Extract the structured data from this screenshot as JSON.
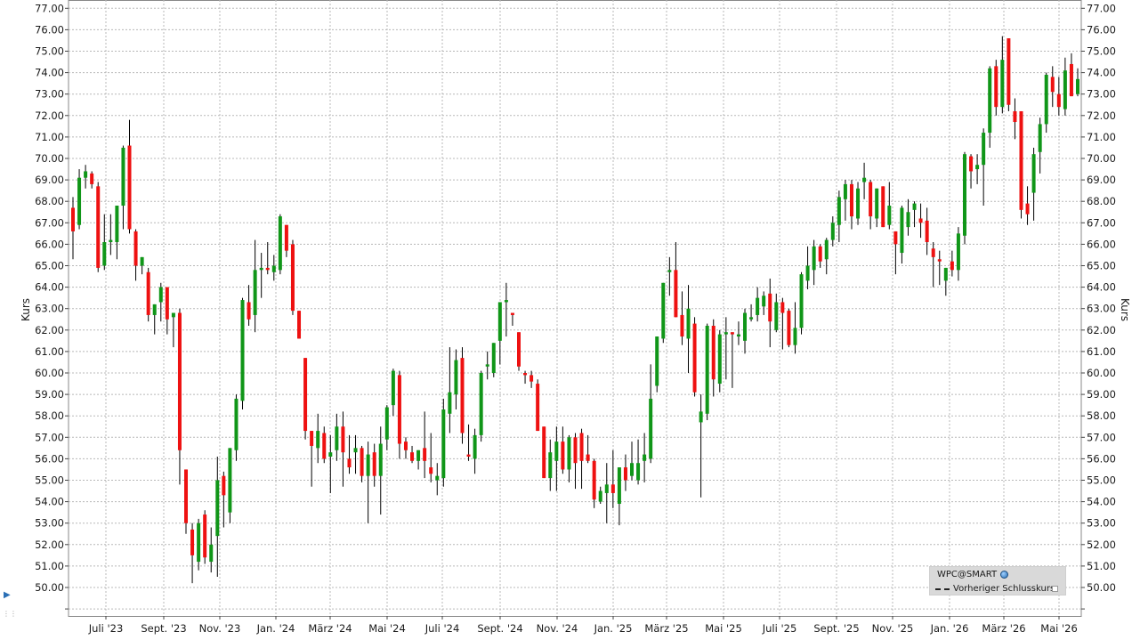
{
  "chart_data": {
    "type": "candlestick",
    "ylabel_left": "Kurs",
    "ylabel_right": "Kurs",
    "ylim": [
      49,
      77
    ],
    "y_ticks": [
      "50.00",
      "51.00",
      "52.00",
      "53.00",
      "54.00",
      "55.00",
      "56.00",
      "57.00",
      "58.00",
      "59.00",
      "60.00",
      "61.00",
      "62.00",
      "63.00",
      "64.00",
      "65.00",
      "66.00",
      "67.00",
      "68.00",
      "69.00",
      "70.00",
      "71.00",
      "72.00",
      "73.00",
      "74.00",
      "75.00",
      "76.00",
      "77.00"
    ],
    "x_labels": [
      "Juli '23",
      "Sept. '23",
      "Nov. '23",
      "Jan. '24",
      "März '24",
      "Mai '24",
      "Juli '24",
      "Sept. '24",
      "Nov. '24",
      "Jan. '25",
      "März '25",
      "Mai '25",
      "Juli '25",
      "Sept. '25",
      "Nov. '25",
      "Jan. '26",
      "März '26",
      "Mai '26"
    ],
    "grid": true,
    "colors": {
      "up": "#109618",
      "down": "#ee1111",
      "grid": "#b8b8b8",
      "wick": "#000000"
    },
    "legend_position": "bottom-right",
    "candles": [
      [
        67.7,
        68.2,
        65.3,
        66.6
      ],
      [
        66.9,
        69.5,
        66.7,
        69.1
      ],
      [
        69.1,
        69.7,
        68.6,
        69.4
      ],
      [
        69.3,
        69.4,
        68.6,
        68.8
      ],
      [
        68.7,
        68.9,
        64.7,
        64.9
      ],
      [
        65.0,
        67.4,
        64.8,
        66.1
      ],
      [
        66.1,
        67.4,
        65.5,
        66.2
      ],
      [
        66.1,
        67.6,
        65.3,
        67.8
      ],
      [
        67.8,
        70.6,
        66.7,
        70.5
      ],
      [
        70.6,
        71.8,
        66.5,
        66.7
      ],
      [
        66.6,
        66.7,
        64.3,
        65.0
      ],
      [
        65.0,
        65.4,
        64.6,
        65.4
      ],
      [
        64.7,
        64.9,
        62.4,
        62.7
      ],
      [
        62.7,
        63.2,
        61.8,
        63.2
      ],
      [
        63.3,
        64.2,
        62.4,
        64.0
      ],
      [
        64.0,
        64.0,
        61.8,
        62.5
      ],
      [
        62.6,
        62.8,
        61.2,
        62.8
      ],
      [
        62.8,
        63.0,
        54.8,
        56.4
      ],
      [
        55.5,
        55.5,
        52.5,
        53.0
      ],
      [
        52.7,
        53.0,
        50.2,
        51.5
      ],
      [
        51.2,
        53.2,
        50.8,
        53.0
      ],
      [
        53.4,
        53.6,
        51.1,
        51.4
      ],
      [
        51.2,
        52.8,
        50.7,
        52.0
      ],
      [
        52.4,
        56.1,
        50.5,
        55.0
      ],
      [
        55.2,
        55.4,
        52.8,
        54.3
      ],
      [
        53.5,
        56.4,
        53.0,
        56.5
      ],
      [
        56.4,
        59.0,
        55.9,
        58.8
      ],
      [
        58.7,
        63.5,
        58.3,
        63.4
      ],
      [
        63.3,
        64.1,
        62.2,
        62.5
      ],
      [
        62.7,
        66.2,
        61.9,
        64.8
      ],
      [
        64.8,
        65.6,
        63.5,
        64.9
      ],
      [
        64.9,
        66.1,
        64.6,
        64.8
      ],
      [
        64.7,
        65.5,
        64.3,
        65.0
      ],
      [
        64.8,
        67.4,
        64.6,
        67.3
      ],
      [
        66.9,
        66.8,
        65.4,
        65.7
      ],
      [
        66.0,
        66.2,
        62.7,
        62.9
      ],
      [
        62.9,
        62.9,
        61.7,
        61.6
      ],
      [
        60.7,
        60.7,
        56.9,
        57.3
      ],
      [
        57.3,
        57.3,
        54.7,
        56.6
      ],
      [
        56.5,
        58.1,
        55.8,
        57.3
      ],
      [
        57.2,
        57.5,
        55.8,
        56.0
      ],
      [
        56.1,
        57.1,
        54.4,
        56.3
      ],
      [
        56.4,
        58.1,
        55.9,
        57.5
      ],
      [
        57.5,
        58.2,
        54.7,
        56.3
      ],
      [
        56.0,
        57.1,
        55.3,
        55.6
      ],
      [
        56.3,
        57.1,
        55.3,
        56.5
      ],
      [
        56.5,
        56.6,
        54.9,
        55.2
      ],
      [
        55.2,
        56.8,
        53.0,
        56.2
      ],
      [
        56.3,
        56.7,
        54.7,
        55.2
      ],
      [
        55.2,
        57.5,
        53.4,
        56.7
      ],
      [
        56.9,
        58.5,
        56.4,
        58.4
      ],
      [
        58.5,
        60.2,
        58.0,
        60.1
      ],
      [
        59.9,
        60.1,
        56.0,
        56.7
      ],
      [
        56.8,
        57.0,
        56.0,
        56.4
      ],
      [
        56.3,
        56.6,
        55.8,
        55.9
      ],
      [
        55.9,
        56.4,
        55.5,
        56.4
      ],
      [
        56.5,
        58.2,
        55.1,
        55.9
      ],
      [
        55.6,
        57.2,
        54.9,
        55.3
      ],
      [
        55.0,
        55.8,
        54.3,
        55.2
      ],
      [
        55.1,
        58.8,
        54.7,
        58.3
      ],
      [
        58.1,
        61.2,
        57.2,
        59.1
      ],
      [
        59.0,
        61.1,
        58.3,
        60.6
      ],
      [
        60.7,
        61.2,
        56.7,
        57.2
      ],
      [
        56.2,
        57.6,
        55.9,
        56.1
      ],
      [
        56.0,
        57.4,
        55.3,
        57.1
      ],
      [
        57.1,
        60.1,
        56.8,
        60.0
      ],
      [
        60.3,
        61.0,
        59.7,
        60.4
      ],
      [
        60.0,
        61.1,
        59.8,
        61.4
      ],
      [
        61.5,
        63.3,
        60.4,
        63.3
      ],
      [
        63.3,
        64.2,
        61.7,
        63.4
      ],
      [
        62.8,
        62.8,
        62.2,
        62.7
      ],
      [
        61.9,
        61.9,
        60.1,
        60.3
      ],
      [
        60.0,
        60.1,
        59.5,
        59.9
      ],
      [
        59.9,
        60.1,
        59.3,
        59.6
      ],
      [
        59.5,
        59.7,
        58.0,
        57.3
      ],
      [
        57.5,
        57.5,
        55.1,
        55.1
      ],
      [
        55.1,
        56.9,
        54.5,
        56.3
      ],
      [
        55.9,
        57.5,
        54.5,
        56.8
      ],
      [
        56.8,
        57.5,
        55.3,
        55.5
      ],
      [
        55.5,
        57.1,
        54.9,
        57.0
      ],
      [
        57.0,
        57.2,
        54.6,
        55.8
      ],
      [
        57.2,
        57.4,
        54.6,
        55.9
      ],
      [
        56.2,
        57.1,
        55.8,
        55.9
      ],
      [
        55.9,
        56.0,
        53.7,
        54.1
      ],
      [
        54.0,
        54.7,
        53.9,
        54.5
      ],
      [
        54.4,
        55.8,
        53.0,
        54.8
      ],
      [
        54.8,
        56.4,
        53.7,
        54.4
      ],
      [
        53.9,
        55.6,
        52.9,
        55.6
      ],
      [
        55.6,
        56.2,
        54.5,
        55.0
      ],
      [
        55.2,
        56.8,
        55.0,
        55.8
      ],
      [
        55.0,
        56.9,
        54.8,
        55.8
      ],
      [
        55.9,
        57.2,
        54.9,
        56.2
      ],
      [
        56.0,
        60.4,
        55.8,
        58.8
      ],
      [
        59.4,
        61.3,
        59.1,
        61.7
      ],
      [
        61.6,
        64.2,
        61.4,
        64.2
      ],
      [
        64.7,
        65.4,
        63.6,
        64.8
      ],
      [
        64.8,
        66.1,
        62.6,
        62.6
      ],
      [
        62.7,
        63.8,
        61.3,
        61.7
      ],
      [
        61.6,
        64.1,
        60.0,
        63.0
      ],
      [
        62.3,
        62.6,
        58.9,
        59.1
      ],
      [
        57.7,
        59.0,
        54.2,
        58.2
      ],
      [
        58.1,
        62.3,
        57.8,
        62.2
      ],
      [
        62.2,
        62.5,
        58.9,
        59.7
      ],
      [
        59.5,
        62.0,
        59.1,
        61.8
      ],
      [
        61.8,
        62.6,
        59.7,
        61.9
      ],
      [
        61.9,
        61.8,
        59.3,
        61.8
      ],
      [
        61.7,
        62.4,
        61.3,
        61.8
      ],
      [
        61.5,
        63.0,
        60.9,
        62.8
      ],
      [
        62.5,
        63.2,
        62.4,
        62.6
      ],
      [
        62.7,
        64.0,
        62.4,
        63.5
      ],
      [
        63.1,
        63.8,
        62.7,
        63.6
      ],
      [
        63.7,
        64.4,
        61.2,
        62.4
      ],
      [
        62.0,
        63.7,
        61.9,
        63.3
      ],
      [
        63.3,
        63.5,
        61.1,
        62.8
      ],
      [
        62.9,
        63.0,
        61.2,
        61.3
      ],
      [
        61.3,
        63.3,
        60.9,
        62.1
      ],
      [
        62.1,
        64.7,
        61.8,
        64.6
      ],
      [
        64.3,
        65.9,
        63.9,
        65.0
      ],
      [
        64.8,
        66.2,
        64.1,
        65.9
      ],
      [
        65.9,
        66.0,
        64.9,
        65.2
      ],
      [
        65.3,
        66.3,
        64.6,
        66.2
      ],
      [
        66.2,
        67.3,
        65.9,
        67.0
      ],
      [
        66.9,
        68.5,
        66.1,
        68.2
      ],
      [
        68.1,
        69.0,
        67.1,
        68.8
      ],
      [
        68.8,
        69.0,
        66.7,
        67.3
      ],
      [
        67.2,
        68.9,
        66.9,
        68.6
      ],
      [
        68.9,
        69.8,
        68.1,
        69.1
      ],
      [
        68.9,
        69.0,
        66.7,
        67.3
      ],
      [
        67.2,
        68.5,
        66.8,
        68.6
      ],
      [
        68.7,
        68.7,
        66.8,
        66.8
      ],
      [
        66.9,
        68.9,
        66.7,
        67.8
      ],
      [
        66.6,
        66.5,
        64.6,
        66.0
      ],
      [
        65.6,
        67.8,
        65.1,
        67.7
      ],
      [
        66.8,
        68.1,
        66.4,
        67.5
      ],
      [
        67.6,
        68.0,
        66.8,
        67.9
      ],
      [
        67.2,
        67.9,
        66.3,
        67.0
      ],
      [
        67.1,
        67.7,
        65.5,
        66.1
      ],
      [
        65.8,
        66.1,
        64.0,
        65.4
      ],
      [
        65.3,
        65.7,
        64.1,
        65.2
      ],
      [
        64.3,
        64.7,
        63.6,
        64.9
      ],
      [
        65.2,
        65.7,
        64.5,
        64.8
      ],
      [
        64.8,
        66.8,
        64.3,
        66.5
      ],
      [
        66.4,
        70.3,
        66.0,
        70.2
      ],
      [
        70.1,
        70.2,
        68.6,
        69.4
      ],
      [
        69.5,
        70.2,
        68.8,
        69.7
      ],
      [
        69.7,
        71.4,
        67.8,
        71.2
      ],
      [
        71.2,
        74.3,
        70.5,
        74.2
      ],
      [
        74.3,
        74.6,
        72.0,
        72.4
      ],
      [
        72.4,
        75.7,
        72.1,
        74.6
      ],
      [
        75.6,
        74.8,
        72.2,
        72.5
      ],
      [
        72.2,
        72.8,
        70.9,
        71.7
      ],
      [
        72.2,
        72.2,
        67.2,
        67.6
      ],
      [
        67.9,
        68.7,
        66.9,
        67.4
      ],
      [
        68.4,
        70.5,
        67.1,
        70.2
      ],
      [
        70.3,
        71.9,
        69.3,
        71.6
      ],
      [
        71.6,
        74.0,
        71.2,
        73.9
      ],
      [
        73.8,
        74.3,
        72.4,
        73.1
      ],
      [
        73.0,
        73.8,
        72.0,
        72.4
      ],
      [
        72.3,
        74.7,
        72.0,
        74.1
      ],
      [
        74.4,
        74.9,
        73.0,
        72.9
      ],
      [
        73.0,
        74.2,
        72.9,
        73.7
      ]
    ]
  },
  "legend": {
    "symbol": "WPC@SMART",
    "icon": "globe-icon",
    "series_label": "Vorheriger Schlusskurs"
  }
}
